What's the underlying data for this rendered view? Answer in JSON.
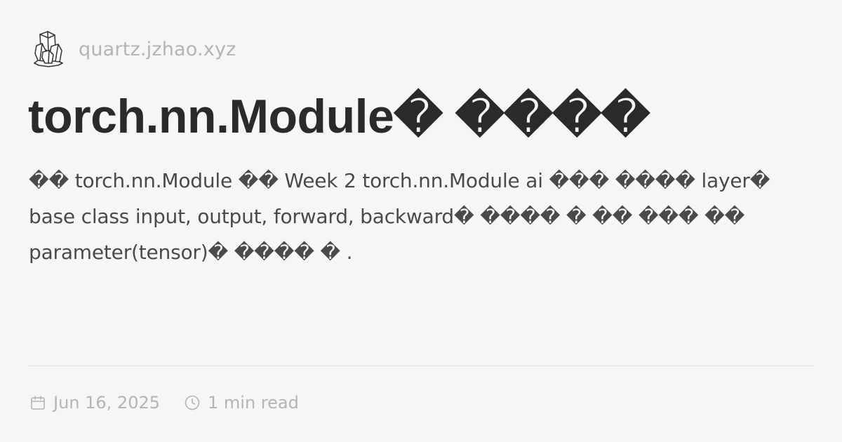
{
  "site": {
    "domain": "quartz.jzhao.xyz",
    "logo_icon": "quartz-crystal-icon"
  },
  "page": {
    "title": "torch.nn.Module� ����",
    "description": "�� torch.nn.Module �� Week 2 torch.nn.Module ai ��� ���� layer� base class input, output, forward, backward� ���� � �� ��� �� parameter(tensor)� ���� � ."
  },
  "meta": {
    "date": "Jun 16, 2025",
    "date_icon": "calendar-icon",
    "reading_time": "1 min read",
    "reading_time_icon": "clock-icon"
  },
  "colors": {
    "background": "#f6f6f7",
    "title": "#2a2a2a",
    "description": "#4a4a4c",
    "muted": "#b4b4b6",
    "divider": "#e3e3e5"
  }
}
